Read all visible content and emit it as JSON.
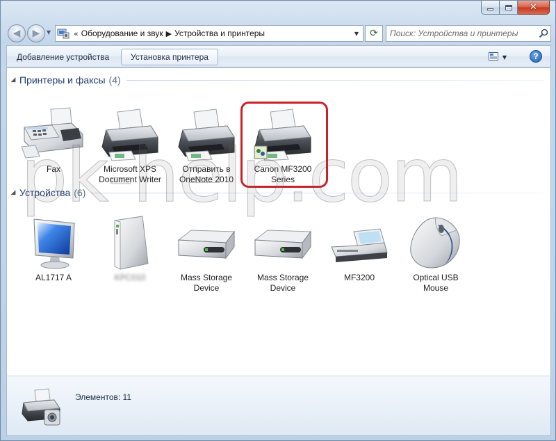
{
  "window": {
    "accent": "#6f8aa8",
    "close_color": "#c7371e"
  },
  "navigation": {
    "breadcrumb_prefix": "«",
    "breadcrumbs": [
      "Оборудование и звук",
      "Устройства и принтеры"
    ],
    "search_placeholder": "Поиск: Устройства и принтеры"
  },
  "commandbar": {
    "add_device": "Добавление устройства",
    "install_printer": "Установка принтера"
  },
  "groups": [
    {
      "title": "Принтеры и факсы",
      "count": "(4)",
      "items": [
        {
          "label": "Fax",
          "icon": "fax-icon"
        },
        {
          "label": "Microsoft XPS Document Writer",
          "icon": "printer-icon"
        },
        {
          "label": "Отправить в OneNote 2010",
          "icon": "printer-icon"
        },
        {
          "label": "Canon MF3200 Series",
          "icon": "printer-icon",
          "highlighted": true
        }
      ]
    },
    {
      "title": "Устройства",
      "count": "(6)",
      "items": [
        {
          "label": "AL1717 A",
          "icon": "monitor-icon"
        },
        {
          "label": "KPC010",
          "icon": "computer-tower-icon",
          "blurred": true
        },
        {
          "label": "Mass Storage Device",
          "icon": "hard-drive-icon"
        },
        {
          "label": "Mass Storage Device",
          "icon": "hard-drive-icon"
        },
        {
          "label": "MF3200",
          "icon": "scanner-icon"
        },
        {
          "label": "Optical USB Mouse",
          "icon": "mouse-icon"
        }
      ]
    }
  ],
  "watermark": "pk-help.com",
  "details": {
    "summary": "Элементов: 11"
  }
}
